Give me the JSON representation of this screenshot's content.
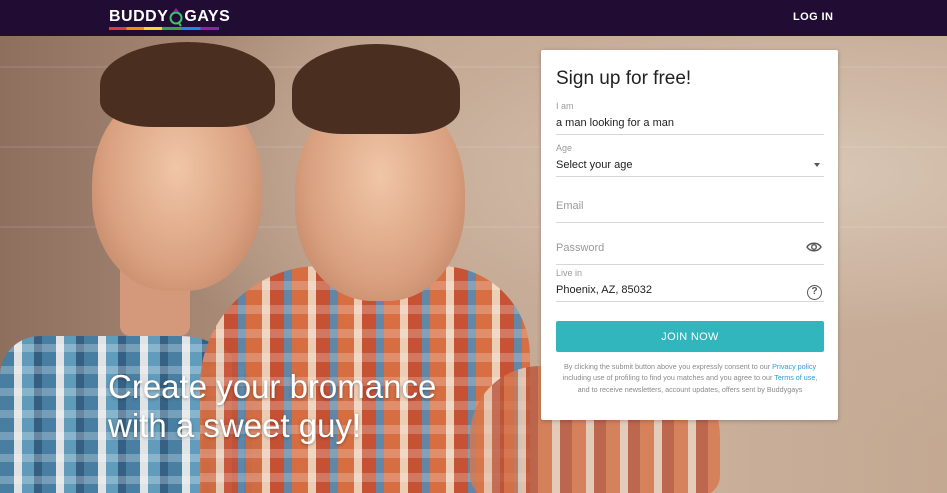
{
  "header": {
    "logo": {
      "text_left": "BUDDY",
      "text_mark": "a",
      "text_right": "GAYS"
    },
    "login_label": "LOG IN"
  },
  "hero": {
    "line1": "Create your bromance",
    "line2": "with a sweet guy!"
  },
  "signup": {
    "title": "Sign up for free!",
    "fields": {
      "i_am": {
        "label": "I am",
        "value": "a man looking for a man"
      },
      "age": {
        "label": "Age",
        "value": "Select your age"
      },
      "email": {
        "placeholder": "Email"
      },
      "password": {
        "placeholder": "Password"
      },
      "live_in": {
        "label": "Live in",
        "value": "Phoenix, AZ, 85032"
      }
    },
    "help_icon_text": "?",
    "join_label": "JOIN NOW",
    "legal": {
      "t1": "By clicking the submit button above you expressly consent to our",
      "privacy_link": "Privacy policy",
      "t2": "including use of profiling to find you matches and you agree to our",
      "terms_link": "Terms of use",
      "t3": ", and to receive newsletters, account updates, offers sent by Buddygays"
    }
  },
  "colors": {
    "header_bg": "#210d33",
    "join_button": "#31b6bd",
    "link": "#2a9fd6"
  },
  "icons": [
    "logo-mark-icon",
    "chevron-down-icon",
    "eye-icon",
    "help-icon"
  ]
}
